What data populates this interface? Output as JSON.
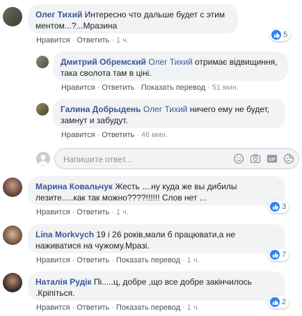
{
  "comments": [
    {
      "author": "Олег Тихий",
      "text": "Интересно что дальше будет с этим ментом...?...Мразина",
      "actions": [
        "Нравится",
        "Ответить"
      ],
      "time": "1 ч.",
      "reactions": "5"
    },
    {
      "author": "Дмитрий Обремский",
      "mention": "Олег Тихий",
      "text": "отримає відвищиння, така сволота там в ціні.",
      "actions": [
        "Нравится",
        "Ответить",
        "Показать перевод"
      ],
      "time": "51 мин."
    },
    {
      "author": "Галина Добрыдень",
      "mention": "Олег Тихий",
      "text": "ничего ему не будет, замнут и забудут.",
      "actions": [
        "Нравится",
        "Ответить"
      ],
      "time": "46 мин."
    },
    {
      "author": "Марина Ковальчук",
      "text": "Жесть ....ну куда же вы дибилы лезите.....как так можно????!!!!!! Слов нет ...",
      "actions": [
        "Нравится",
        "Ответить"
      ],
      "time": "1 ч.",
      "reactions": "3"
    },
    {
      "author": "Lina Morkvych",
      "text": "19 і 26 років,мали б працювати,а не наживатися на чужому.Мразі.",
      "actions": [
        "Нравится",
        "Ответить",
        "Показать перевод"
      ],
      "time": "1 ч.",
      "reactions": "7"
    },
    {
      "author": "Наталія Рудік",
      "text": "Пі.....ц, добре ,що все добре закінчилось .Кріпіться.",
      "actions": [
        "Нравится",
        "Ответить",
        "Показать перевод"
      ],
      "time": "1 ч.",
      "reactions": "2"
    }
  ],
  "reply_box": {
    "placeholder": "Напишите ответ..."
  },
  "icons": [
    "emoji-icon",
    "camera-icon",
    "gif-icon",
    "sticker-icon"
  ],
  "colors": {
    "link": "#385898",
    "bubble": "#f2f3f5",
    "like": "#2e81f4"
  }
}
